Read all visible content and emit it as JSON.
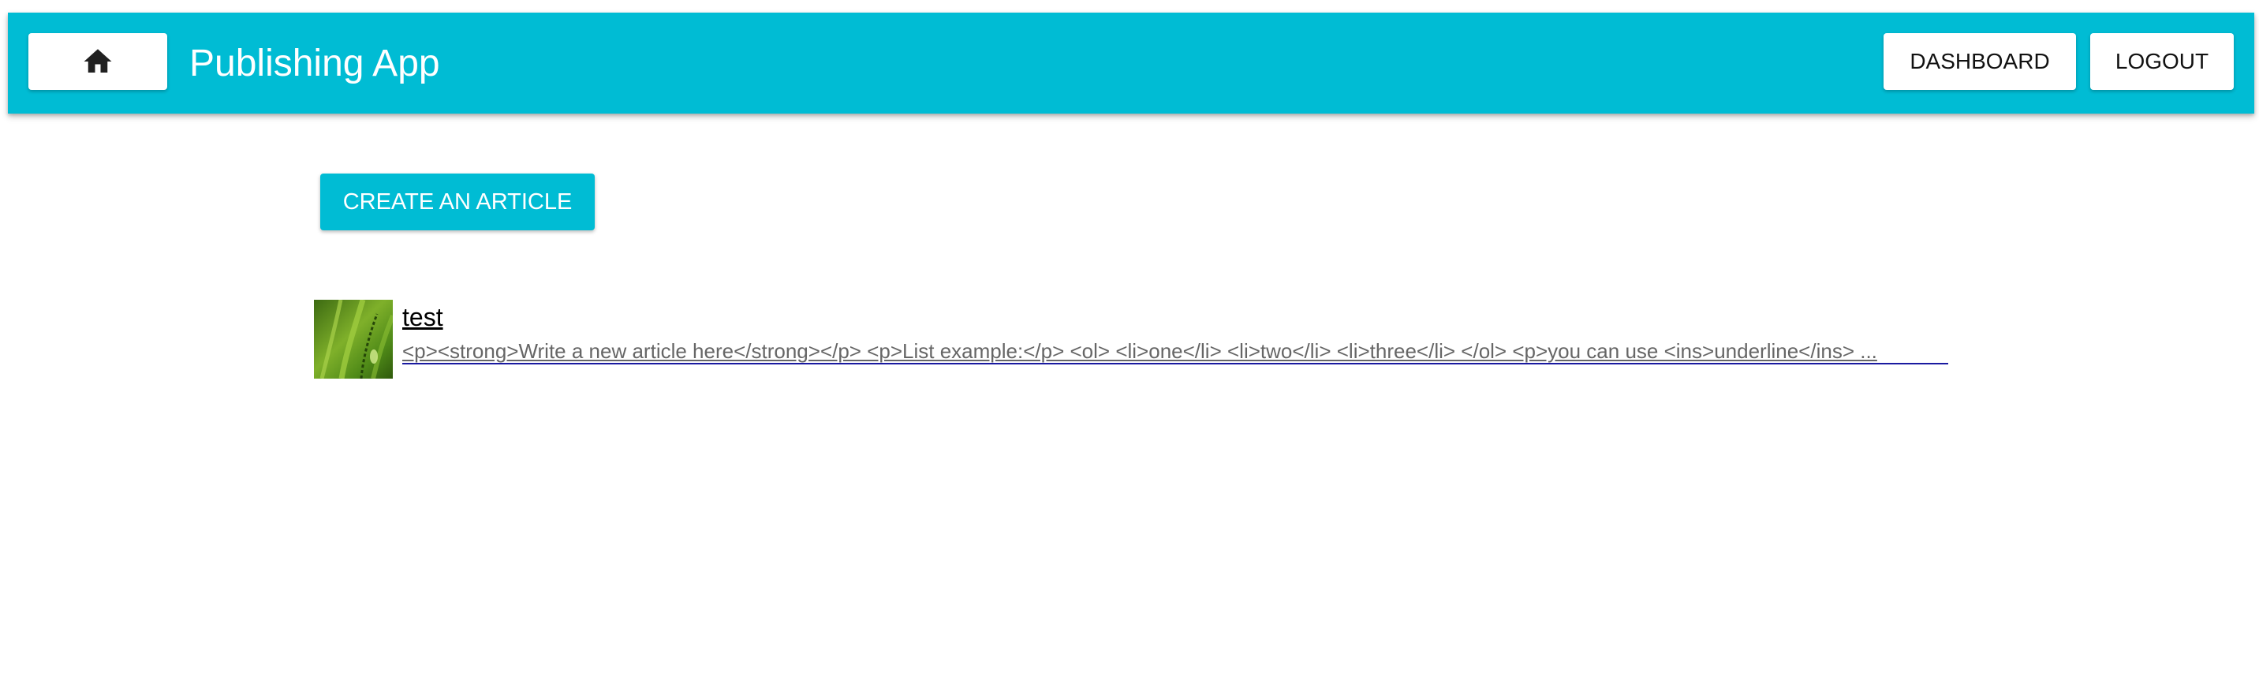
{
  "header": {
    "title": "Publishing App",
    "home_icon": "home-icon",
    "buttons": {
      "dashboard": "DASHBOARD",
      "logout": "LOGOUT"
    }
  },
  "main": {
    "create_button": "CREATE AN ARTICLE",
    "articles": [
      {
        "title": "test",
        "excerpt": "<p><strong>Write a new article here</strong></p> <p>List example:</p> <ol> <li>one</li> <li>two</li> <li>three</li> </ol> <p>you can use <ins>underline</ins> ..."
      }
    ]
  },
  "colors": {
    "primary": "#00bcd4",
    "button_background": "#ffffff",
    "excerpt_text": "#666666"
  }
}
